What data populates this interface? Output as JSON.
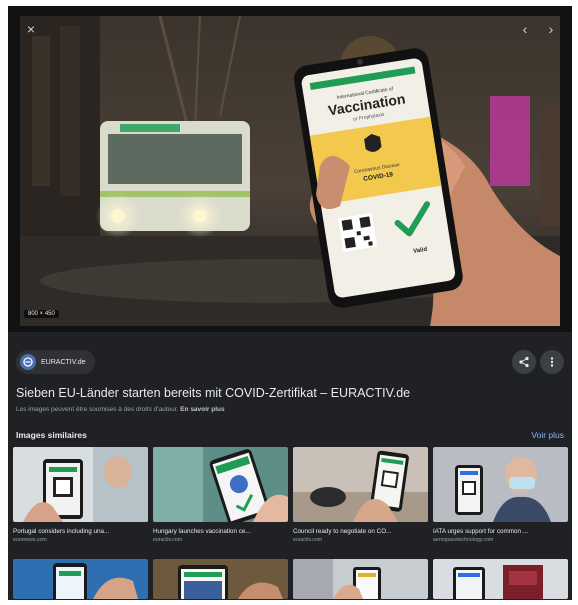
{
  "viewer": {
    "close_glyph": "×",
    "prev_glyph": "‹",
    "next_glyph": "›",
    "image_dimensions": "800 × 450",
    "phone_screen": {
      "header_small": "International Certificate of",
      "heading": "Vaccination",
      "heading_sub": "or Prophylaxis",
      "disease_label": "Coronavirus Disease",
      "disease_name": "COVID-19",
      "valid_label": "Valid"
    }
  },
  "source": {
    "name": "EURACTIV.de",
    "share_icon": "share-icon",
    "more_icon": "more-vert-icon"
  },
  "result": {
    "title": "Sieben EU-Länder starten bereits mit COVID-Zertifikat – EURACTIV.de",
    "copyright_note": "Les images peuvent être soumises à des droits d'auteur.",
    "learn_more": "En savoir plus"
  },
  "similar": {
    "heading": "Images similaires",
    "see_more": "Voir plus",
    "cards": [
      {
        "title": "Portugal considers including una...",
        "source": "euronews.com"
      },
      {
        "title": "Hungary launches vaccination ce...",
        "source": "euractiv.com"
      },
      {
        "title": "Council ready to negotiate on CO...",
        "source": "euractiv.com"
      },
      {
        "title": "IATA urges support for common ...",
        "source": "aerospacetechnology.com"
      }
    ]
  },
  "colors": {
    "panel_bg": "#202124",
    "chip_bg": "#303134",
    "link_blue": "#8ab4f8",
    "cert_green": "#1f9d55",
    "cert_yellow": "#f2c94c"
  }
}
